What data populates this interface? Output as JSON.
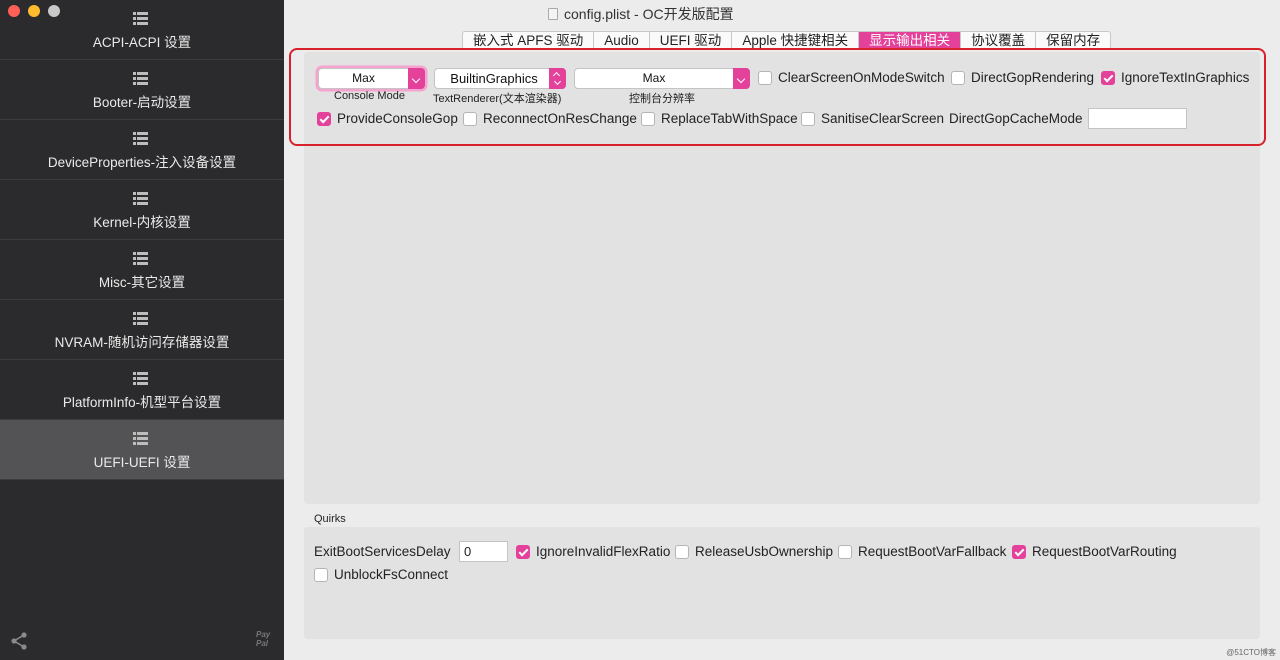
{
  "window": {
    "title": "config.plist - OC开发版配置"
  },
  "sidebar": {
    "items": [
      {
        "label": "ACPI-ACPI 设置",
        "active": false
      },
      {
        "label": "Booter-启动设置",
        "active": false
      },
      {
        "label": "DeviceProperties-注入设备设置",
        "active": false
      },
      {
        "label": "Kernel-内核设置",
        "active": false
      },
      {
        "label": "Misc-其它设置",
        "active": false
      },
      {
        "label": "NVRAM-随机访问存储器设置",
        "active": false
      },
      {
        "label": "PlatformInfo-机型平台设置",
        "active": false
      },
      {
        "label": "UEFI-UEFI 设置",
        "active": true
      }
    ],
    "paypal_logo": "Pay Pal"
  },
  "tabs": [
    {
      "label": "嵌入式 APFS 驱动",
      "active": false
    },
    {
      "label": "Audio",
      "active": false
    },
    {
      "label": "UEFI 驱动",
      "active": false
    },
    {
      "label": "Apple 快捷键相关",
      "active": false
    },
    {
      "label": "显示输出相关",
      "active": true
    },
    {
      "label": "协议覆盖",
      "active": false
    },
    {
      "label": "保留内存",
      "active": false
    }
  ],
  "output": {
    "console_mode": {
      "value": "Max",
      "caption": "Console Mode"
    },
    "text_renderer": {
      "value": "BuiltinGraphics",
      "caption": "TextRenderer(文本渲染器)"
    },
    "resolution": {
      "value": "Max",
      "caption": "控制台分辨率"
    },
    "checkboxes_row1": [
      {
        "label": "ClearScreenOnModeSwitch",
        "checked": false
      },
      {
        "label": "DirectGopRendering",
        "checked": false
      },
      {
        "label": "IgnoreTextInGraphics",
        "checked": true
      }
    ],
    "checkboxes_row2": [
      {
        "label": "ProvideConsoleGop",
        "checked": true
      },
      {
        "label": "ReconnectOnResChange",
        "checked": false
      },
      {
        "label": "ReplaceTabWithSpace",
        "checked": false
      },
      {
        "label": "SanitiseClearScreen",
        "checked": false
      }
    ],
    "direct_gop_cache_mode": {
      "label": "DirectGopCacheMode",
      "value": ""
    }
  },
  "quirks": {
    "title": "Quirks",
    "exit_boot_services_delay": {
      "label": "ExitBootServicesDelay",
      "value": "0"
    },
    "checkboxes": [
      {
        "label": "IgnoreInvalidFlexRatio",
        "checked": true
      },
      {
        "label": "ReleaseUsbOwnership",
        "checked": false
      },
      {
        "label": "RequestBootVarFallback",
        "checked": false
      },
      {
        "label": "RequestBootVarRouting",
        "checked": true
      },
      {
        "label": "UnblockFsConnect",
        "checked": false
      }
    ]
  },
  "watermark": "@51CTO博客",
  "colors": {
    "accent": "#e4419b",
    "sidebar_bg": "#2b2b2d",
    "highlight": "#d8222b"
  }
}
